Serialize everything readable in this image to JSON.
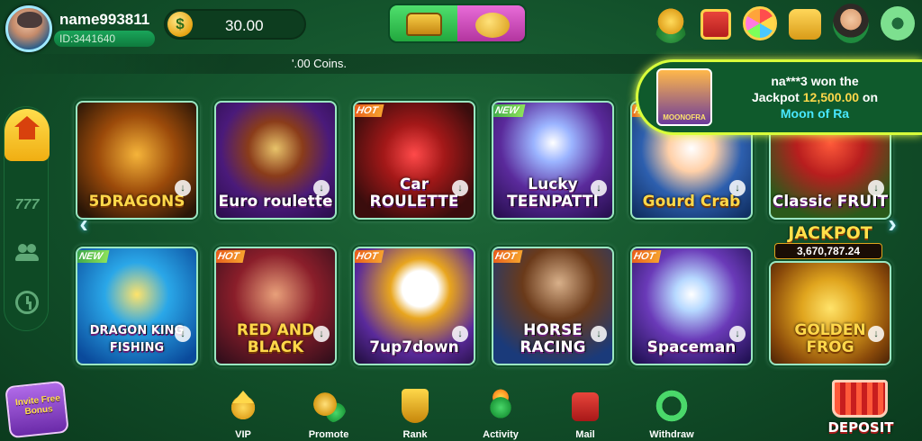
{
  "header": {
    "username": "name993811",
    "user_id": "ID:3441640",
    "currency_symbol": "$",
    "balance": "30.00",
    "icons": [
      "chest-icon",
      "piggy-bank-icon",
      "gold-ingots-icon",
      "gift-box-icon",
      "lucky-wheel-icon",
      "cash-bag-icon",
      "customer-service-icon",
      "settings-gear-icon"
    ]
  },
  "marquee": {
    "text": "'.00 Coins."
  },
  "jackpot_notice": {
    "line1": "na***3 won the",
    "line2_prefix": "Jackpot ",
    "amount": "12,500.00",
    "line2_suffix": " on",
    "game": "Moon of Ra",
    "thumb_label": "MOONOFRA"
  },
  "left_nav": {
    "items": [
      "home-icon",
      "slots-777-icon",
      "people-icon",
      "history-icon"
    ],
    "slots_label": "777"
  },
  "games": [
    {
      "name": "5DRAGONS",
      "badge": ""
    },
    {
      "name": "Euro roulette",
      "badge": ""
    },
    {
      "name": "Car ROULETTE",
      "badge": "HOT"
    },
    {
      "name": "Lucky TEENPATTI",
      "badge": "NEW"
    },
    {
      "name": "Gourd Crab",
      "badge": "HOT"
    },
    {
      "name": "Classic FRUIT",
      "badge": ""
    },
    {
      "name": "DRAGON KING FISHING",
      "badge": "NEW"
    },
    {
      "name": "RED AND BLACK",
      "badge": "HOT"
    },
    {
      "name": "7up7down",
      "badge": "HOT"
    },
    {
      "name": "HORSE RACING",
      "badge": "HOT"
    },
    {
      "name": "Spaceman",
      "badge": "HOT"
    },
    {
      "name": "GOLDEN FROG",
      "badge": ""
    }
  ],
  "jackpot": {
    "label": "JACKPOT",
    "amount": "3,670,787.24"
  },
  "bottom_nav": {
    "invite": "Invite Free Bonus",
    "vip": "VIP",
    "promote": "Promote",
    "rank": "Rank",
    "activity": "Activity",
    "mail": "Mail",
    "withdraw": "Withdraw",
    "deposit": "DEPOSIT"
  }
}
